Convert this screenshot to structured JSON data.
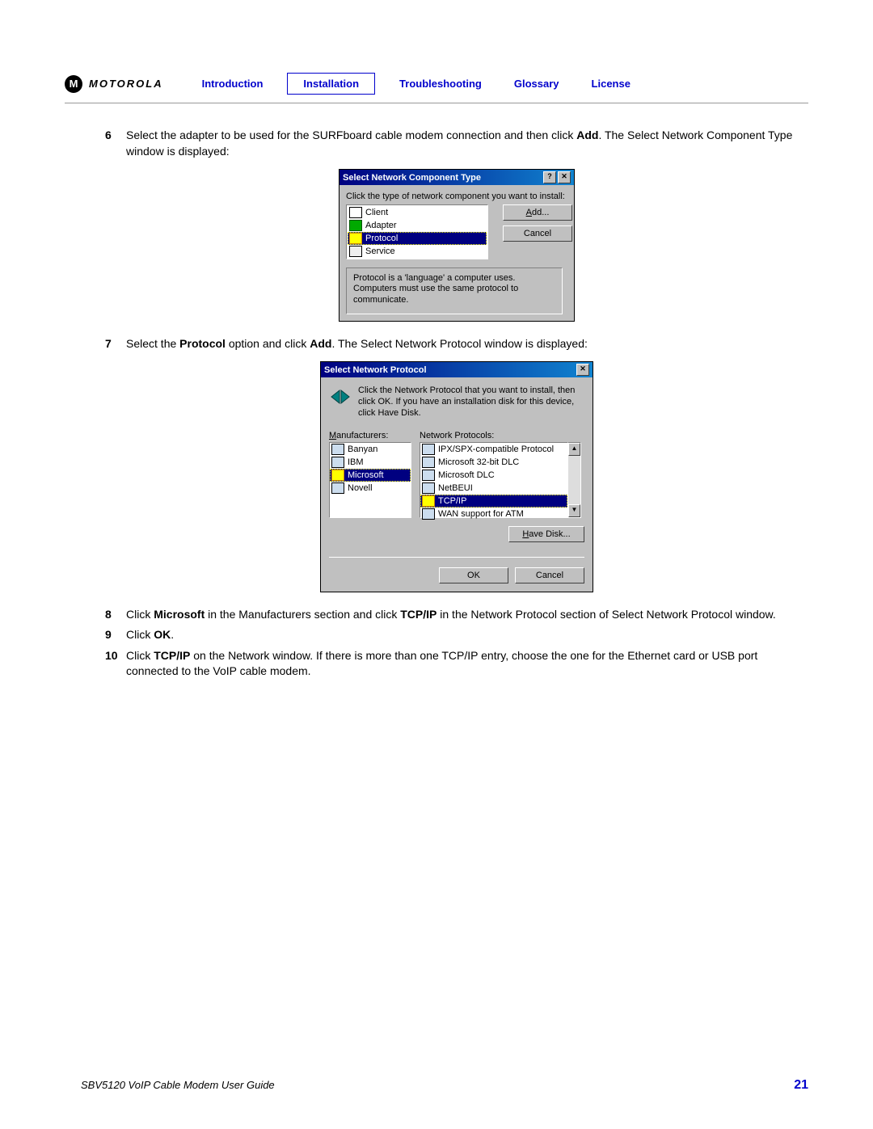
{
  "header": {
    "brand": "MOTOROLA",
    "nav": [
      "Introduction",
      "Installation",
      "Troubleshooting",
      "Glossary",
      "License"
    ],
    "active_index": 1
  },
  "steps": {
    "s6": {
      "num": "6",
      "text_a": "Select the adapter to be used for the SURFboard cable modem connection and then click ",
      "bold_a": "Add",
      "text_b": ". The Select Network Component Type window is displayed:"
    },
    "s7": {
      "num": "7",
      "text_a": "Select the ",
      "bold_a": "Protocol",
      "text_b": " option and click ",
      "bold_b": "Add",
      "text_c": ". The Select Network Protocol window is displayed:"
    },
    "s8": {
      "num": "8",
      "text_a": "Click ",
      "bold_a": "Microsoft",
      "text_b": " in the Manufacturers section and click ",
      "bold_b": "TCP/IP",
      "text_c": " in the Network Protocol section of Select Network Protocol window."
    },
    "s9": {
      "num": "9",
      "text_a": "Click ",
      "bold_a": "OK",
      "text_b": "."
    },
    "s10": {
      "num": "10",
      "text_a": "Click ",
      "bold_a": "TCP/IP",
      "text_b": " on the Network window. If there is more than one TCP/IP entry, choose the one for the Ethernet card or USB port connected to the VoIP cable modem."
    }
  },
  "dialog1": {
    "title": "Select Network Component Type",
    "instruction": "Click the type of network component you want to install:",
    "items": [
      "Client",
      "Adapter",
      "Protocol",
      "Service"
    ],
    "selected_index": 2,
    "buttons": {
      "add": "Add...",
      "cancel": "Cancel"
    },
    "desc": "Protocol is a 'language' a computer uses. Computers must use the same protocol to communicate."
  },
  "dialog2": {
    "title": "Select Network Protocol",
    "instruction": "Click the Network Protocol that you want to install, then click OK. If you have an installation disk for this device, click Have Disk.",
    "mfg_label": "Manufacturers:",
    "proto_label": "Network Protocols:",
    "manufacturers": [
      "Banyan",
      "IBM",
      "Microsoft",
      "Novell"
    ],
    "mfg_selected_index": 2,
    "protocols": [
      "IPX/SPX-compatible Protocol",
      "Microsoft 32-bit DLC",
      "Microsoft DLC",
      "NetBEUI",
      "TCP/IP",
      "WAN support for ATM"
    ],
    "proto_selected_index": 4,
    "buttons": {
      "have_disk": "Have Disk...",
      "ok": "OK",
      "cancel": "Cancel"
    }
  },
  "footer": {
    "title": "SBV5120 VoIP Cable Modem User Guide",
    "page": "21"
  }
}
